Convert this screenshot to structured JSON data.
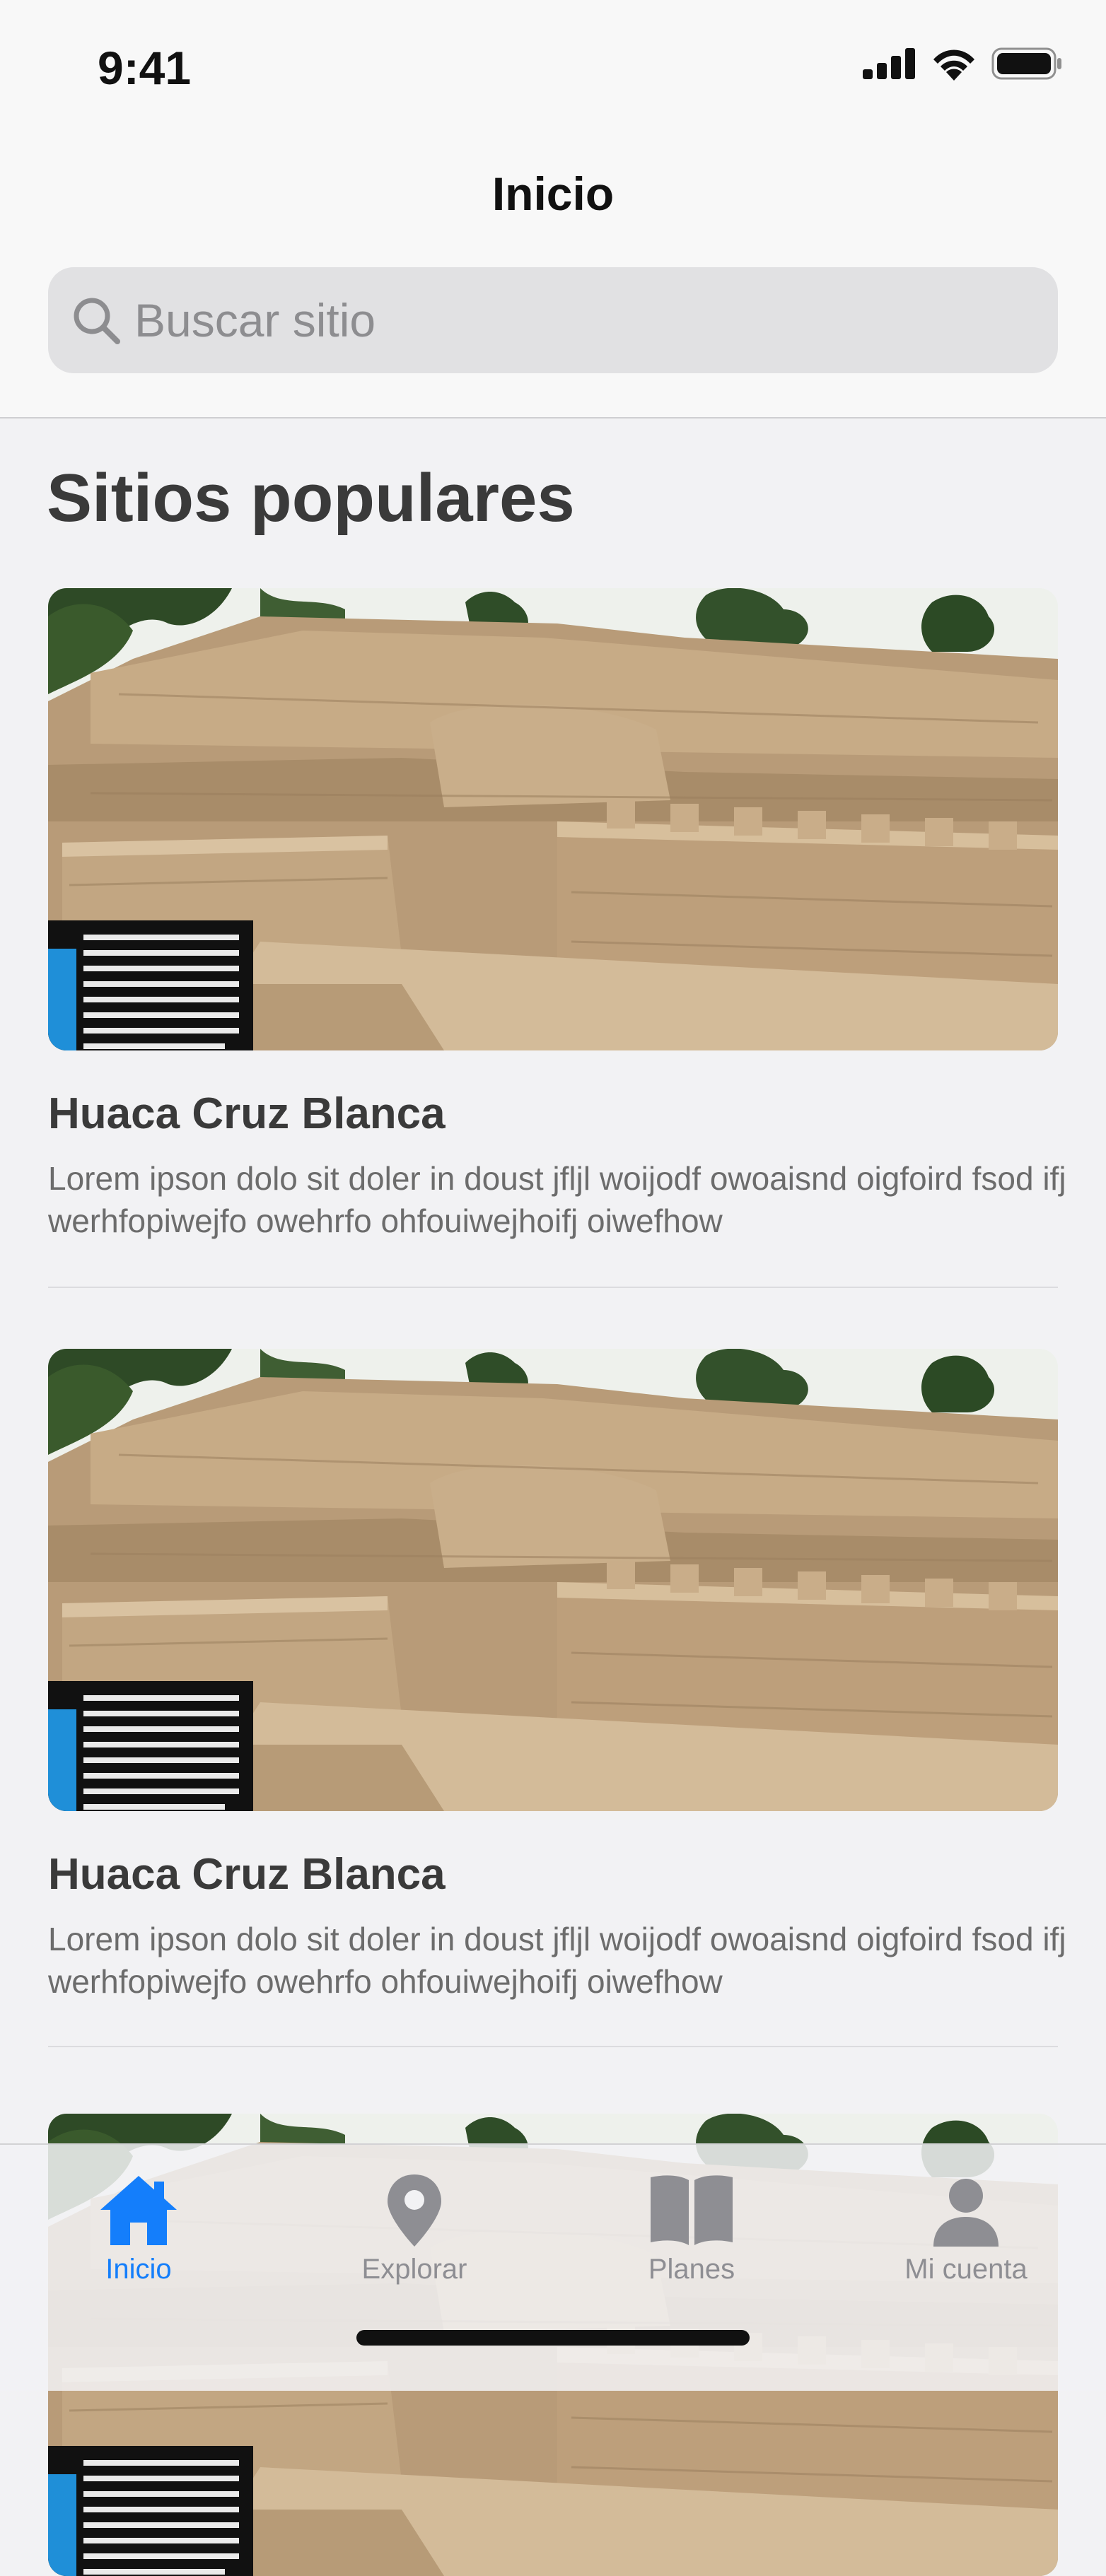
{
  "status_bar": {
    "time": "9:41"
  },
  "nav": {
    "title": "Inicio"
  },
  "search": {
    "placeholder": "Buscar sitio"
  },
  "section": {
    "title": "Sitios populares"
  },
  "cards": [
    {
      "title": "Huaca Cruz Blanca",
      "description": "Lorem ipson dolo sit doler in doust jfljl woijodf owoaisnd oigfoird fsod ifj werhfopiwejfo owehrfo ohfouiwejhoifj oiwefhow",
      "sign_text": "La huaca Cruz Blanca tiene cuartos y plazas construidos en tapia y adobes, algunos estuvieron techados por las Huella de postes en sus pisos, otros tienen restos de pintura blanca en sus muros, esto hace a la Huaca Blanca uno de"
    },
    {
      "title": "Huaca Cruz Blanca",
      "description": "Lorem ipson dolo sit doler in doust jfljl woijodf owoaisnd oigfoird fsod ifj werhfopiwejfo owehrfo ohfouiwejhoifj oiwefhow",
      "sign_text": "La huaca Cruz Blanca tiene cuartos y plazas construidos en tapia y adobes, algunos estuvieron techados por las Huella de postes en sus pisos, otros tienen restos de pintura blanca en sus muros, esto hace a la Huaca Blanca uno de"
    }
  ],
  "tabbar": {
    "tabs": [
      {
        "label": "Inicio",
        "icon": "home-icon",
        "active": true
      },
      {
        "label": "Explorar",
        "icon": "location-pin-icon",
        "active": false
      },
      {
        "label": "Planes",
        "icon": "book-icon",
        "active": false
      },
      {
        "label": "Mi cuenta",
        "icon": "user-icon",
        "active": false
      }
    ]
  },
  "colors": {
    "accent": "#147efb",
    "inactive_tab": "#8e8e93",
    "background": "#f2f2f4",
    "search_field": "#e1e1e3"
  }
}
